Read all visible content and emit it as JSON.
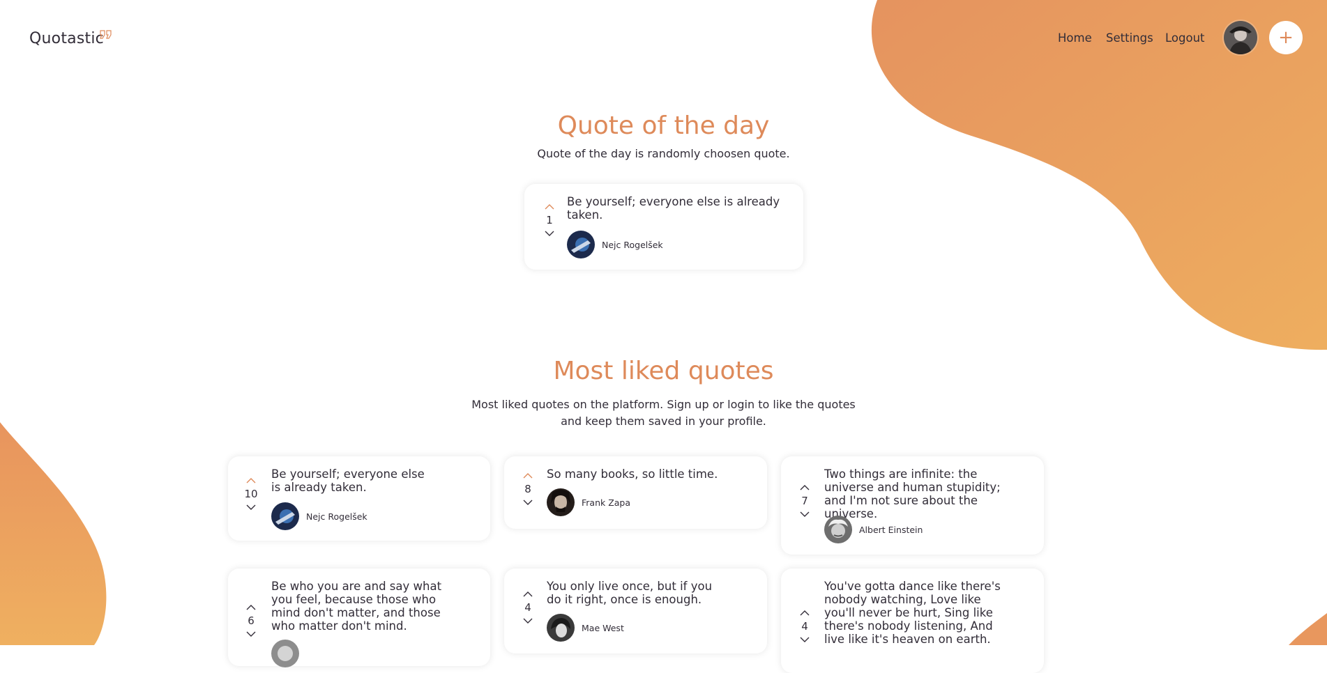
{
  "header": {
    "logo": "Quotastic",
    "nav": [
      {
        "label": "Home"
      },
      {
        "label": "Settings"
      },
      {
        "label": "Logout"
      }
    ],
    "add_label": "+"
  },
  "quote_of_day": {
    "title": "Quote of the day",
    "subtitle": "Quote of the day is randomly choosen quote.",
    "quote": {
      "text": "Be yourself; everyone else is already taken.",
      "votes": "1",
      "author": "Nejc Rogelšek"
    }
  },
  "most_liked": {
    "title": "Most liked quotes",
    "subtitle_line1": "Most liked quotes on the platform. Sign up or login to like the quotes",
    "subtitle_line2": "and keep them saved in your profile.",
    "quotes": [
      {
        "text": "Be yourself; everyone else is already taken.",
        "votes": "10",
        "author": "Nejc Rogelšek"
      },
      {
        "text": "So many books, so little time.",
        "votes": "8",
        "author": "Frank Zapa"
      },
      {
        "text": "Two things are infinite: the universe and human stupidity; and I'm not sure about the universe.",
        "votes": "7",
        "author": "Albert Einstein"
      },
      {
        "text": "Be who you are and say what you feel, because those who mind don't matter, and those who matter don't mind.",
        "votes": "6",
        "author": ""
      },
      {
        "text": "You only live once, but if you do it right, once is enough.",
        "votes": "4",
        "author": "Mae West"
      },
      {
        "text": "You've gotta dance like there's nobody watching, Love like you'll never be hurt, Sing like there's nobody listening, And live like it's heaven on earth.",
        "votes": "4",
        "author": ""
      }
    ]
  },
  "colors": {
    "accent": "#DE8A5A",
    "blob_start": "#E6955E",
    "blob_end": "#EFAE5F",
    "text": "#322d38"
  }
}
